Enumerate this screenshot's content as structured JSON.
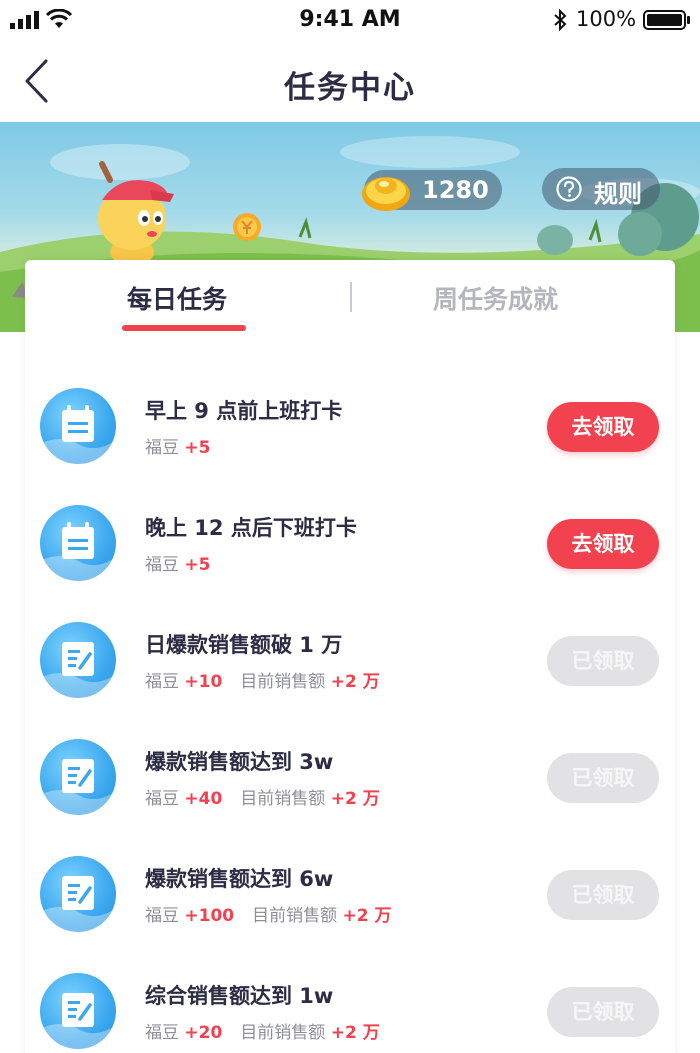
{
  "status_bar": {
    "time": "9:41 AM",
    "battery_percent": "100%",
    "icons": [
      "signal-icon",
      "wifi-icon",
      "bluetooth-icon",
      "battery-icon"
    ]
  },
  "nav": {
    "title": "任务中心",
    "back_icon": "chevron-left-icon"
  },
  "banner": {
    "balance": "1280",
    "rules_label": "规则",
    "icons": [
      "gold-ingot-icon",
      "question-circle-icon",
      "coin-icon",
      "mascot-illustration"
    ]
  },
  "tabs": [
    {
      "label": "每日任务",
      "active": true
    },
    {
      "label": "周任务成就",
      "active": false
    }
  ],
  "tasks": [
    {
      "title": "早上 9 点前上班打卡",
      "reward_label": "福豆",
      "reward": "+5",
      "button": "去领取",
      "state": "available",
      "icon": "calendar-icon"
    },
    {
      "title": "晚上 12 点后下班打卡",
      "reward_label": "福豆",
      "reward": "+5",
      "button": "去领取",
      "state": "available",
      "icon": "calendar-icon"
    },
    {
      "title": "日爆款销售额破 1 万",
      "reward_label": "福豆",
      "reward": "+10",
      "progress_label": "目前销售额",
      "progress": "+2 万",
      "button": "已领取",
      "state": "claimed",
      "icon": "edit-note-icon"
    },
    {
      "title": "爆款销售额达到 3w",
      "reward_label": "福豆",
      "reward": "+40",
      "progress_label": "目前销售额",
      "progress": "+2 万",
      "button": "已领取",
      "state": "claimed",
      "icon": "edit-note-icon"
    },
    {
      "title": "爆款销售额达到 6w",
      "reward_label": "福豆",
      "reward": "+100",
      "progress_label": "目前销售额",
      "progress": "+2 万",
      "button": "已领取",
      "state": "claimed",
      "icon": "edit-note-icon"
    },
    {
      "title": "综合销售额达到 1w",
      "reward_label": "福豆",
      "reward": "+20",
      "progress_label": "目前销售额",
      "progress": "+2 万",
      "button": "已领取",
      "state": "claimed",
      "icon": "edit-note-icon"
    }
  ],
  "colors": {
    "accent": "#f2424f",
    "text_dark": "#2c2c44",
    "text_muted": "#8f8f9a",
    "disabled_button": "#e2e2e4",
    "icon_blue": "#3aa7ee"
  }
}
